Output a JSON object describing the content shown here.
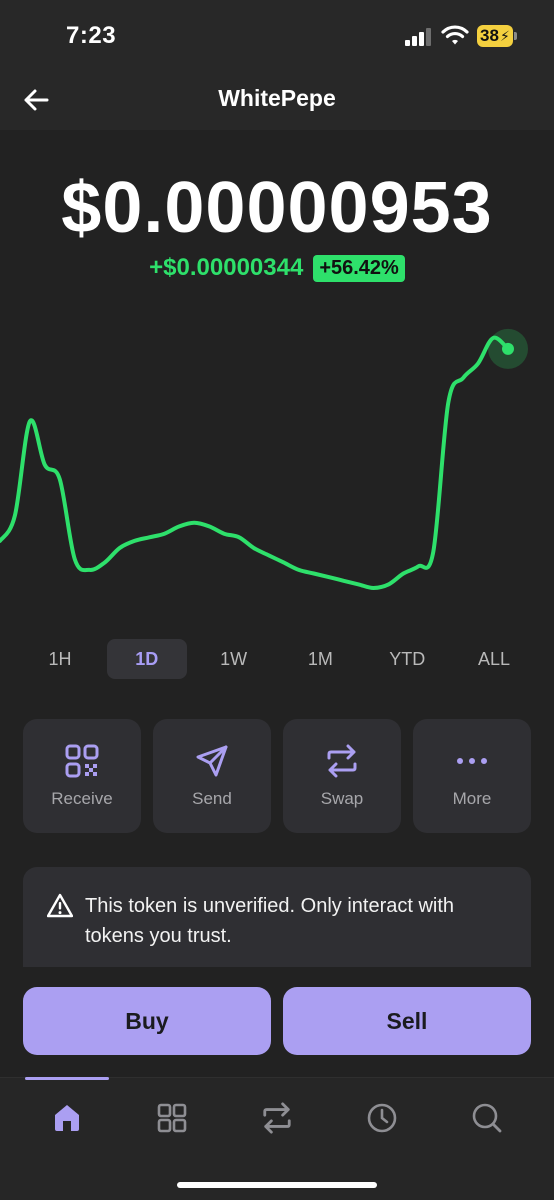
{
  "status_bar": {
    "time": "7:23",
    "battery": "38"
  },
  "header": {
    "title": "WhitePepe"
  },
  "token": {
    "price": "$0.00000953",
    "change_abs": "+$0.00000344",
    "change_pct": "+56.42%"
  },
  "colors": {
    "accent": "#ab9ff2",
    "positive": "#2ee06b",
    "background": "#222222",
    "card": "#2f2f33"
  },
  "chart_data": {
    "type": "line",
    "title": "",
    "series": [
      {
        "values": [
          5.5,
          6.2,
          8.8,
          7.6,
          7.2,
          5.0,
          4.7,
          4.9,
          5.3,
          5.5,
          5.6,
          5.7,
          5.9,
          6.0,
          5.9,
          5.7,
          5.6,
          5.3,
          5.1,
          4.9,
          4.7,
          4.6,
          4.5,
          4.4,
          4.3,
          4.2,
          4.3,
          4.6,
          4.8,
          5.2,
          9.3,
          10.0,
          10.4,
          11.1,
          10.8
        ]
      }
    ],
    "current_point_highlighted": true
  },
  "time_ranges": [
    {
      "label": "1H",
      "active": false
    },
    {
      "label": "1D",
      "active": true
    },
    {
      "label": "1W",
      "active": false
    },
    {
      "label": "1M",
      "active": false
    },
    {
      "label": "YTD",
      "active": false
    },
    {
      "label": "ALL",
      "active": false
    }
  ],
  "actions": [
    {
      "label": "Receive",
      "icon": "qr-code-icon"
    },
    {
      "label": "Send",
      "icon": "send-icon"
    },
    {
      "label": "Swap",
      "icon": "swap-icon"
    },
    {
      "label": "More",
      "icon": "more-icon"
    }
  ],
  "warning": {
    "text": "This token is unverified. Only interact with tokens you trust.",
    "icon": "warning-icon"
  },
  "trade": {
    "buy_label": "Buy",
    "sell_label": "Sell"
  },
  "nav": [
    {
      "icon": "home-icon",
      "active": true
    },
    {
      "icon": "grid-icon",
      "active": false
    },
    {
      "icon": "swap-icon",
      "active": false
    },
    {
      "icon": "clock-icon",
      "active": false
    },
    {
      "icon": "search-icon",
      "active": false
    }
  ]
}
